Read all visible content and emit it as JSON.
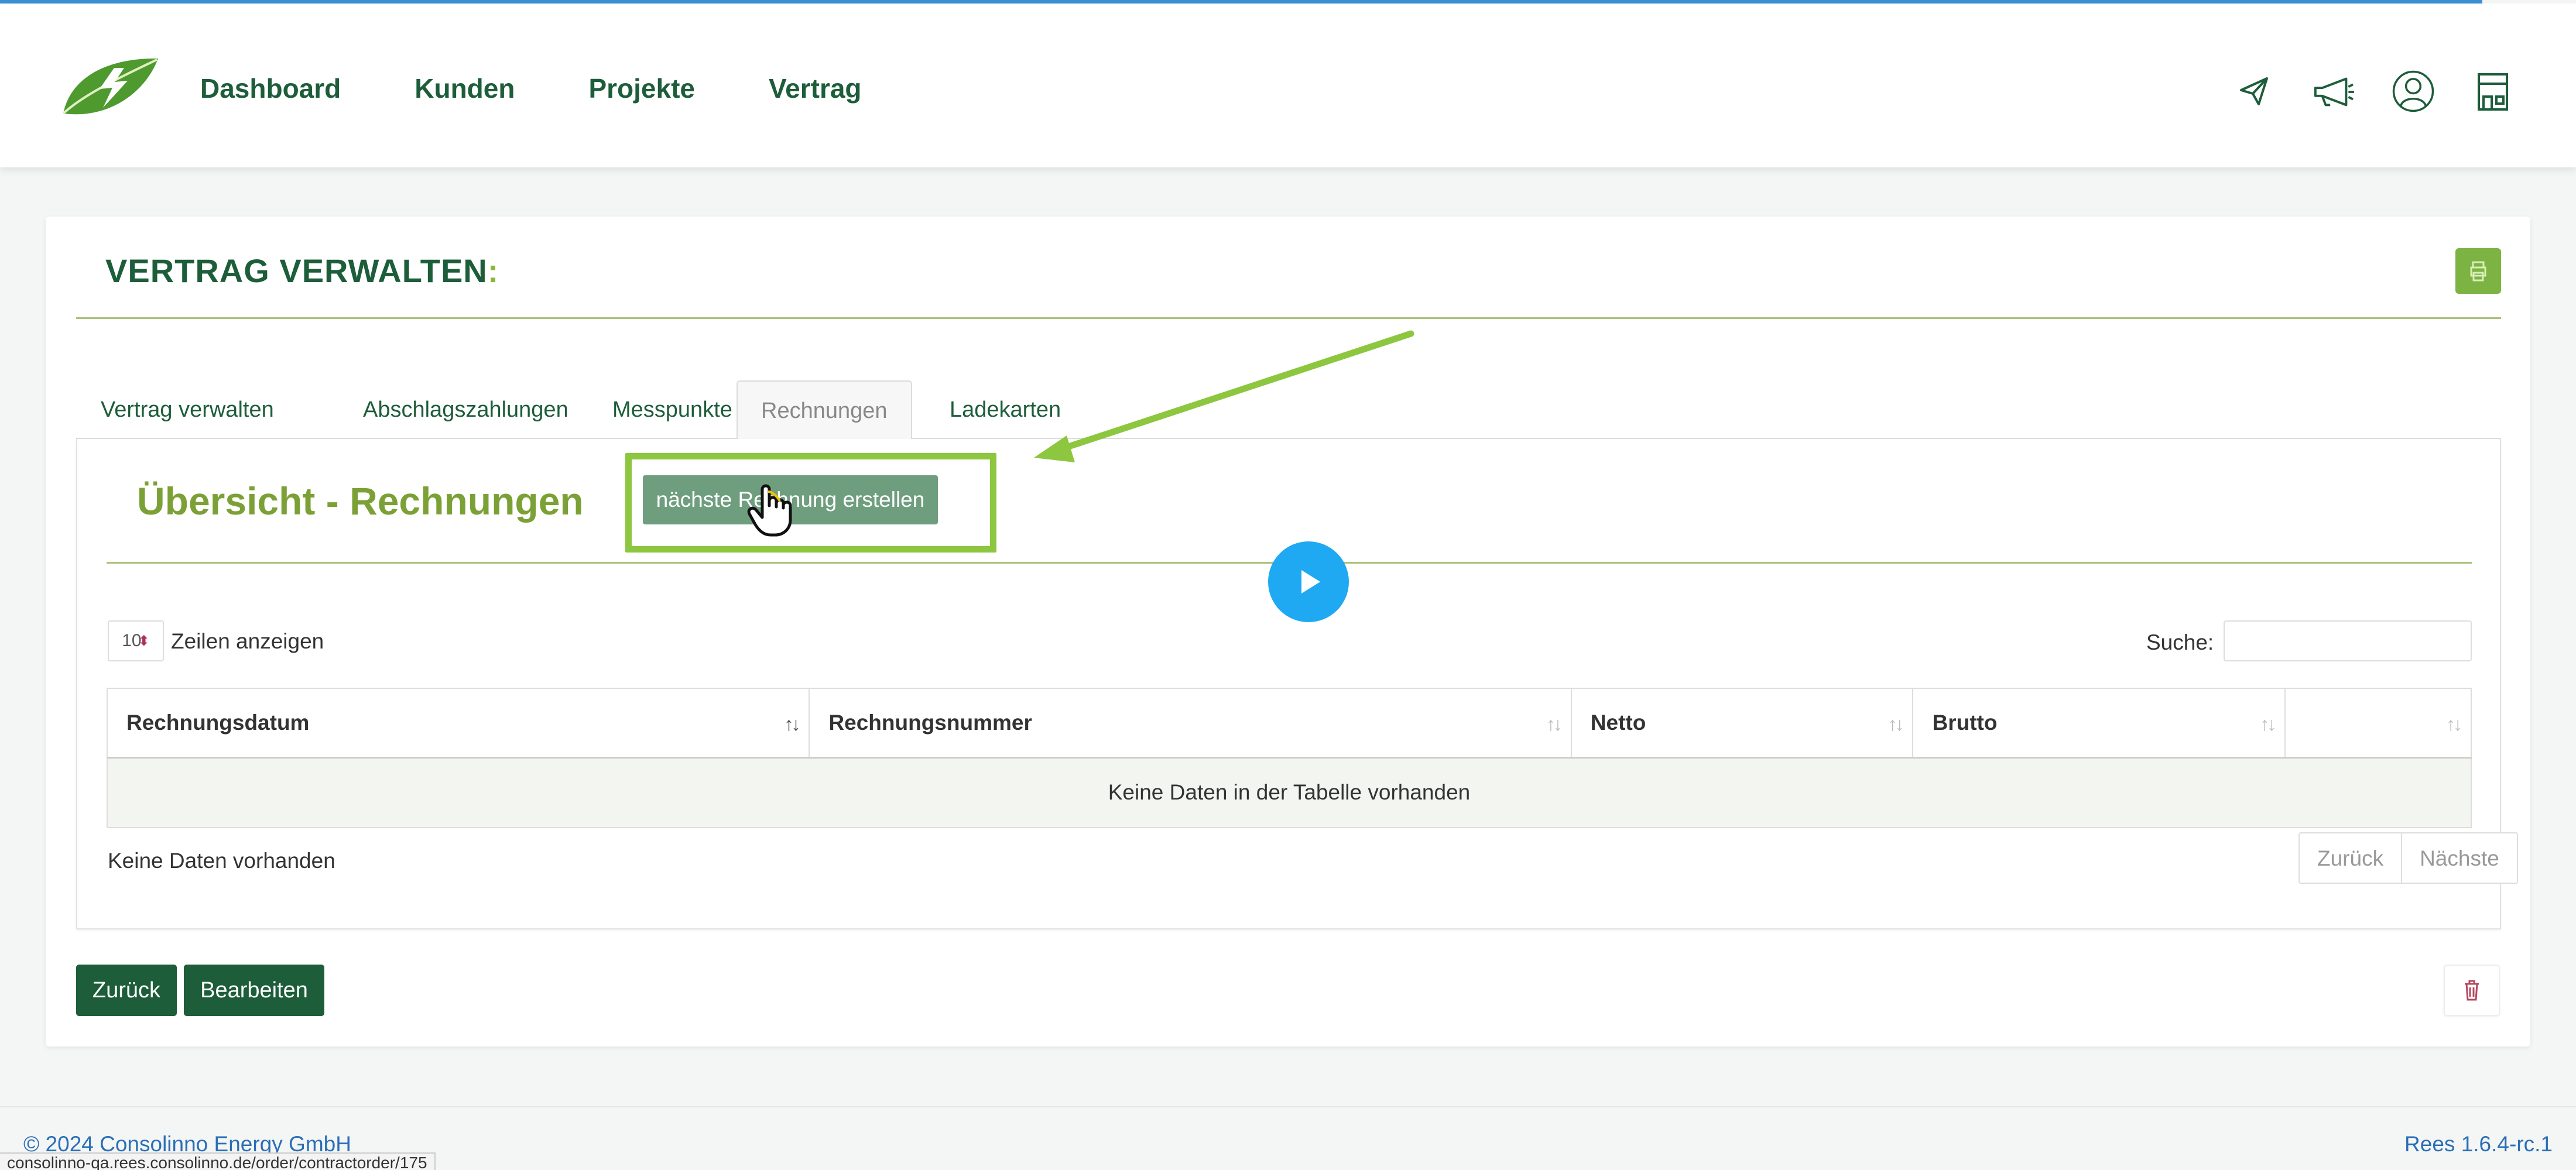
{
  "nav": {
    "items": [
      "Dashboard",
      "Kunden",
      "Projekte",
      "Vertrag"
    ]
  },
  "top_icons": [
    "paper-plane-icon",
    "megaphone-icon",
    "user-circle-icon",
    "shop-icon"
  ],
  "page": {
    "title_main": "VERTRAG VERWALTEN",
    "title_colon": ":"
  },
  "tabs": [
    "Vertrag verwalten",
    "Abschlagszahlungen",
    "Messpunkte",
    "Rechnungen",
    "Ladekarten"
  ],
  "active_tab": "Rechnungen",
  "panel": {
    "title": "Übersicht - Rechnungen",
    "create_button": "nächste Rechnung erstellen"
  },
  "table_controls": {
    "length_value": "10",
    "length_label": "Zeilen anzeigen",
    "search_label": "Suche:",
    "search_value": ""
  },
  "table": {
    "columns": [
      "Rechnungsdatum",
      "Rechnungsnummer",
      "Netto",
      "Brutto",
      ""
    ],
    "empty_message": "Keine Daten in der Tabelle vorhanden",
    "info": "Keine Daten vorhanden",
    "prev": "Zurück",
    "next": "Nächste"
  },
  "actions": {
    "back": "Zurück",
    "edit": "Bearbeiten"
  },
  "footer": {
    "copyright": "© 2024 Consolinno Energy GmbH",
    "version": "Rees 1.6.4-rc.1",
    "status_url": "consolinno-qa.rees.consolinno.de/order/contractorder/175"
  },
  "colors": {
    "brand_dark": "#1d5d3a",
    "brand_green": "#8ab838",
    "highlight": "#8dc63f",
    "play": "#1ea9f2"
  }
}
